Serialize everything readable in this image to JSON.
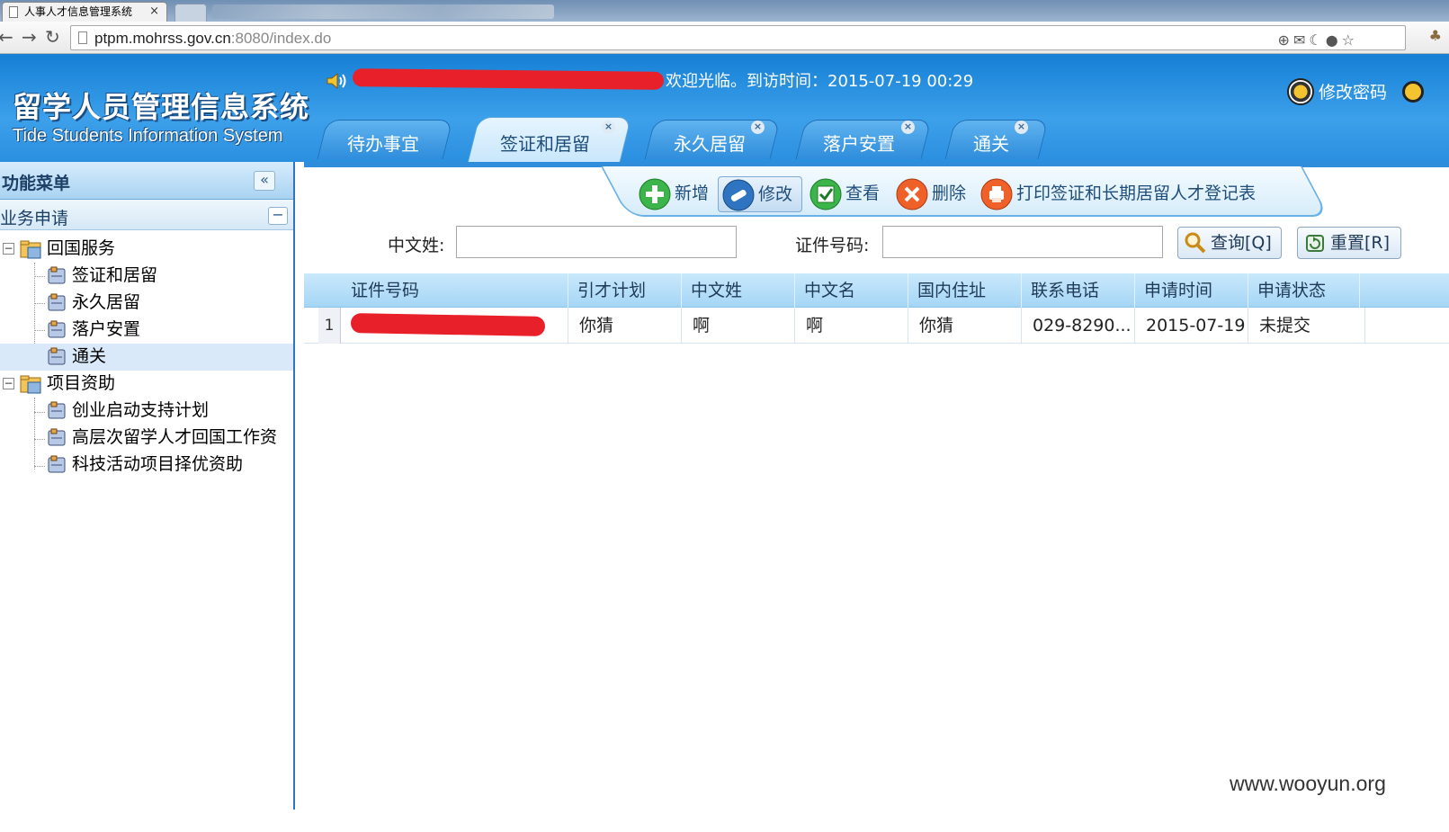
{
  "browser": {
    "tab_title": "人事人才信息管理系统",
    "tab_close": "×",
    "url_host": "ptpm.mohrss.gov.cn",
    "url_rest": ":8080/index.do",
    "back_icon": "back-arrow-icon",
    "forward_icon": "forward-arrow-icon",
    "reload_icon": "reload-icon"
  },
  "header": {
    "logo_cn": "留学人员管理信息系统",
    "logo_en": "Tide Students Information System",
    "welcome": "欢迎光临。到访时间：2015-07-19 00:29",
    "change_password": "修改密码"
  },
  "module_tabs": [
    {
      "label": "待办事宜",
      "active": false,
      "closable": false
    },
    {
      "label": "签证和居留",
      "active": true,
      "closable": true
    },
    {
      "label": "永久居留",
      "active": false,
      "closable": true
    },
    {
      "label": "落户安置",
      "active": false,
      "closable": true
    },
    {
      "label": "通关",
      "active": false,
      "closable": true
    }
  ],
  "sidebar": {
    "title": "功能菜单",
    "collapse": "«",
    "section": "业务申请",
    "section_toggle": "−",
    "tree": [
      {
        "label": "回国服务",
        "type": "folder",
        "expander": "−"
      },
      {
        "label": "签证和居留",
        "type": "leaf"
      },
      {
        "label": "永久居留",
        "type": "leaf"
      },
      {
        "label": "落户安置",
        "type": "leaf"
      },
      {
        "label": "通关",
        "type": "leaf",
        "selected": true
      },
      {
        "label": "项目资助",
        "type": "folder",
        "expander": "−"
      },
      {
        "label": "创业启动支持计划",
        "type": "leaf"
      },
      {
        "label": "高层次留学人才回国工作资",
        "type": "leaf"
      },
      {
        "label": "科技活动项目择优资助",
        "type": "leaf"
      }
    ]
  },
  "actions": {
    "add": "新增",
    "edit": "修改",
    "view": "查看",
    "delete": "删除",
    "print": "打印签证和长期居留人才登记表"
  },
  "search": {
    "surname_label": "中文姓:",
    "surname_value": "",
    "cert_label": "证件号码:",
    "cert_value": "",
    "query_button": "查询[Q]",
    "reset_button": "重置[R]"
  },
  "grid": {
    "columns": [
      "证件号码",
      "引才计划",
      "中文姓",
      "中文名",
      "国内住址",
      "联系电话",
      "申请时间",
      "申请状态"
    ],
    "rows": [
      {
        "num": "1",
        "cert": "",
        "plan": "你猜",
        "surname": "啊",
        "given": "啊",
        "address": "你猜",
        "phone": "029-8290...",
        "date": "2015-07-19",
        "status": "未提交"
      }
    ]
  },
  "watermark": "www.wooyun.org",
  "colors": {
    "header_blue": "#2b8fe0",
    "accent_dark": "#1f4d7a",
    "redaction": "#e8202a"
  }
}
